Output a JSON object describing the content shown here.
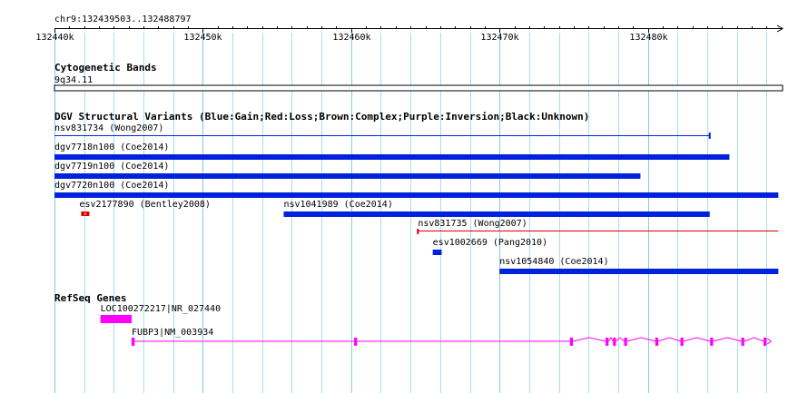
{
  "ruler": {
    "title": "chr9:132439503..132488797",
    "ticks": [
      {
        "label": "132440k",
        "pos": 132440000
      },
      {
        "label": "132450k",
        "pos": 132450000
      },
      {
        "label": "132460k",
        "pos": 132460000
      },
      {
        "label": "132470k",
        "pos": 132470000
      },
      {
        "label": "132480k",
        "pos": 132480000
      }
    ]
  },
  "cytobands": {
    "title": "Cytogenetic Bands",
    "band": "9q34.11"
  },
  "dgv": {
    "title": "DGV Structural Variants (Blue:Gain;Red:Loss;Brown:Complex;Purple:Inversion;Black:Unknown)",
    "variants": [
      {
        "label": "nsv831734 (Wong2007)",
        "start": 132440000,
        "end": 132484170,
        "type": "gain",
        "style": "thin-end"
      },
      {
        "label": "dgv7718n100 (Coe2014)",
        "start": 132440000,
        "end": 132485500,
        "type": "gain",
        "style": "thick"
      },
      {
        "label": "dgv7719n100 (Coe2014)",
        "start": 132440000,
        "end": 132479500,
        "type": "gain",
        "style": "thick"
      },
      {
        "label": "dgv7720n100 (Coe2014)",
        "start": 132440000,
        "end": 132488797,
        "type": "gain",
        "style": "thick"
      },
      {
        "label": "esv2177890 (Bentley2008)",
        "start": 132441800,
        "end": 132442400,
        "type": "loss",
        "style": "small"
      },
      {
        "label": "nsv1041989 (Coe2014)",
        "start": 132455450,
        "end": 132484170,
        "type": "gain",
        "style": "thick"
      },
      {
        "label": "nsv831735 (Wong2007)",
        "start": 132464500,
        "end": 132488797,
        "type": "loss",
        "style": "thin-start"
      },
      {
        "label": "esv1002669 (Pang2010)",
        "start": 132465500,
        "end": 132466100,
        "type": "gain",
        "style": "thick"
      },
      {
        "label": "nsv1054840 (Coe2014)",
        "start": 132470000,
        "end": 132488797,
        "type": "gain",
        "style": "thick"
      }
    ]
  },
  "refseq": {
    "title": "RefSeq Genes",
    "genes": [
      {
        "label": "LOC100272217|NR_027440",
        "start": 132443100,
        "end": 132445200,
        "exons": [
          [
            132443100,
            132445200
          ]
        ]
      },
      {
        "label": "FUBP3|NM_003934",
        "start": 132445200,
        "end": 132488300,
        "exons": [
          [
            132445200,
            132445400
          ],
          [
            132460200,
            132460400
          ],
          [
            132474750,
            132474950
          ],
          [
            132477150,
            132477350
          ],
          [
            132477650,
            132477850
          ],
          [
            132478400,
            132478600
          ],
          [
            132480500,
            132480700
          ],
          [
            132482200,
            132482400
          ],
          [
            132484200,
            132484400
          ],
          [
            132486300,
            132486500
          ],
          [
            132487800,
            132488000
          ]
        ]
      }
    ]
  },
  "colors": {
    "gain": "#0022dd",
    "loss": "#dd0000",
    "gene": "#ff00ff",
    "grid": "#aadcf0"
  }
}
